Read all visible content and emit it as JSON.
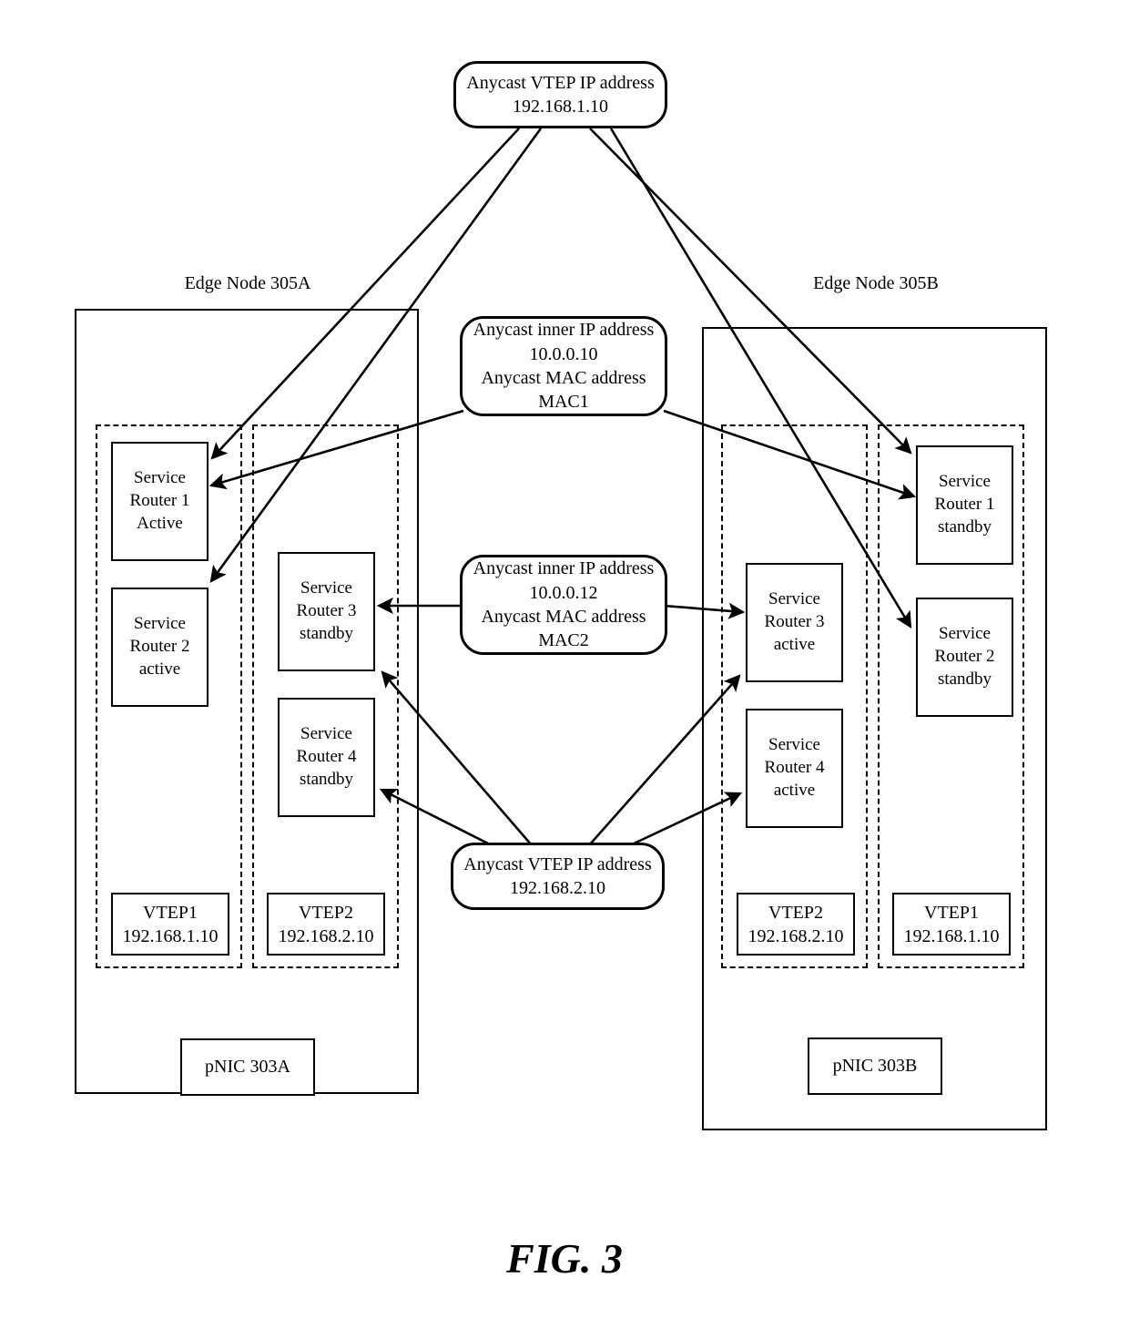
{
  "figure": {
    "label": "FIG. 3"
  },
  "bubbles": {
    "top_vtep": {
      "line1": "Anycast VTEP IP address",
      "line2": "192.168.1.10"
    },
    "inner_mac1": {
      "line1": "Anycast inner IP address",
      "line2": "10.0.0.10",
      "line3": "Anycast MAC address",
      "line4": "MAC1"
    },
    "inner_mac2": {
      "line1": "Anycast inner IP address",
      "line2": "10.0.0.12",
      "line3": "Anycast MAC address",
      "line4": "MAC2"
    },
    "bottom_vtep": {
      "line1": "Anycast VTEP IP address",
      "line2": "192.168.2.10"
    }
  },
  "edge_node_a": {
    "caption": "Edge Node 305A",
    "pnic": "pNIC 303A",
    "group1": {
      "routers": [
        {
          "line1": "Service",
          "line2": "Router 1",
          "line3": "Active"
        },
        {
          "line1": "Service",
          "line2": "Router 2",
          "line3": "active"
        }
      ],
      "vtep": {
        "line1": "VTEP1",
        "line2": "192.168.1.10"
      }
    },
    "group2": {
      "routers": [
        {
          "line1": "Service",
          "line2": "Router 3",
          "line3": "standby"
        },
        {
          "line1": "Service",
          "line2": "Router 4",
          "line3": "standby"
        }
      ],
      "vtep": {
        "line1": "VTEP2",
        "line2": "192.168.2.10"
      }
    }
  },
  "edge_node_b": {
    "caption": "Edge Node 305B",
    "pnic": "pNIC 303B",
    "group1": {
      "routers": [
        {
          "line1": "Service",
          "line2": "Router 3",
          "line3": "active"
        },
        {
          "line1": "Service",
          "line2": "Router 4",
          "line3": "active"
        }
      ],
      "vtep": {
        "line1": "VTEP2",
        "line2": "192.168.2.10"
      }
    },
    "group2": {
      "routers": [
        {
          "line1": "Service",
          "line2": "Router 1",
          "line3": "standby"
        },
        {
          "line1": "Service",
          "line2": "Router 2",
          "line3": "standby"
        }
      ],
      "vtep": {
        "line1": "VTEP1",
        "line2": "192.168.1.10"
      }
    }
  },
  "style": {
    "stroke": "#000000",
    "background": "#ffffff"
  }
}
